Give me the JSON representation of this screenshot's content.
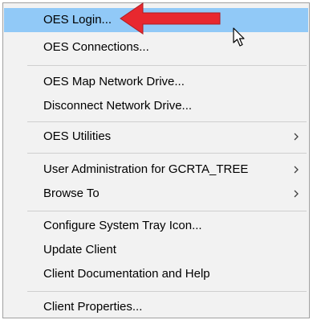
{
  "menu": {
    "items": [
      {
        "label": "OES Login..."
      },
      {
        "label": "OES Connections..."
      },
      {
        "label": "OES Map Network Drive..."
      },
      {
        "label": "Disconnect Network Drive..."
      },
      {
        "label": "OES Utilities"
      },
      {
        "label": "User Administration for GCRTA_TREE"
      },
      {
        "label": "Browse To"
      },
      {
        "label": "Configure System Tray Icon..."
      },
      {
        "label": "Update Client"
      },
      {
        "label": "Client Documentation and Help"
      },
      {
        "label": "Client Properties..."
      }
    ]
  },
  "colors": {
    "highlight": "#91c9f7",
    "menu_bg": "#f2f2f2",
    "annotation_arrow": "#e8282f"
  },
  "icons": {
    "submenu": "chevron-right-icon",
    "annotation": "red-arrow-icon",
    "pointer": "mouse-cursor-icon"
  }
}
